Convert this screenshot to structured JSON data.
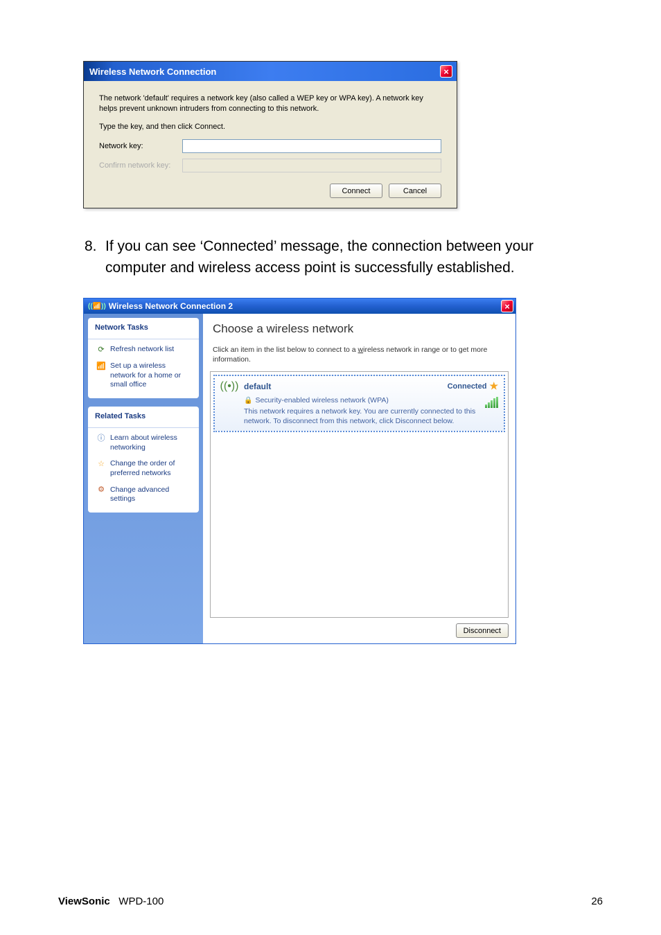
{
  "dialog1": {
    "title": "Wireless Network Connection",
    "intro": "The network 'default' requires a network key (also called a WEP key or WPA key). A network key helps prevent unknown intruders from connecting to this network.",
    "prompt": "Type the key, and then click Connect.",
    "label_key": "Network key:",
    "label_confirm": "Confirm network key:",
    "btn_connect": "Connect",
    "btn_cancel": "Cancel"
  },
  "instruction": {
    "num": "8.",
    "text": "If you can see ‘Connected’ message, the connection between your computer and wireless access point is successfully established."
  },
  "dialog2": {
    "title": "Wireless Network Connection 2",
    "sidebar": {
      "panel1_hd": "Network Tasks",
      "refresh": "Refresh network list",
      "setup": "Set up a wireless network for a home or small office",
      "panel2_hd": "Related Tasks",
      "learn": "Learn about wireless networking",
      "order": "Change the order of preferred networks",
      "advanced": "Change advanced settings"
    },
    "main": {
      "heading": "Choose a wireless network",
      "sub_a": "Click an item in the list below to connect to a ",
      "sub_u": "w",
      "sub_b": "ireless network in range or to get more information.",
      "net": {
        "ssid": "default",
        "status": "Connected",
        "security": "Security-enabled wireless network (WPA)",
        "desc": "This network requires a network key. You are currently connected to this network. To disconnect from this network, click Disconnect below."
      },
      "disconnect": "Disconnect"
    }
  },
  "footer": {
    "brand": "ViewSonic",
    "model": "WPD-100",
    "page": "26"
  }
}
